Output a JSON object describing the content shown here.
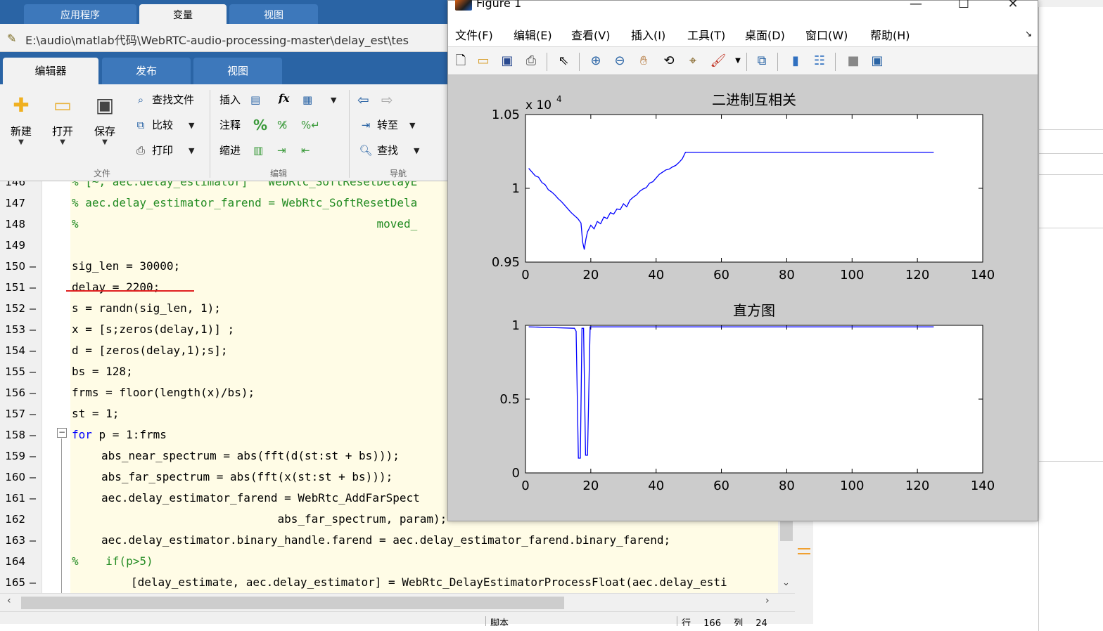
{
  "main": {
    "top_tabs": [
      "应用程序",
      "变量",
      "视图"
    ],
    "file_path": "E:\\audio\\matlab代码\\WebRTC-audio-processing-master\\delay_est\\tes",
    "ribbon_tabs": [
      "编辑器",
      "发布",
      "视图"
    ],
    "ribbon": {
      "new": "新建",
      "open": "打开",
      "save": "保存",
      "find_files": "查找文件",
      "compare": "比较",
      "print": "打印",
      "insert": "插入",
      "comment": "注释",
      "indent": "缩进",
      "goto": "转至",
      "find": "查找",
      "group_file": "文件",
      "group_edit": "编辑",
      "group_nav": "导航",
      "fx": "fx",
      "percent": "%"
    }
  },
  "editor": {
    "lines": [
      {
        "n": "146",
        "dash": "",
        "text": "% [~, aec.delay_estimator]   WebRtc_SoftResetDelayE",
        "cls": "cmt",
        "indent": 0
      },
      {
        "n": "147",
        "dash": "",
        "text": "% aec.delay_estimator_farend = WebRtc_SoftResetDela",
        "cls": "cmt",
        "indent": 0
      },
      {
        "n": "148",
        "dash": "",
        "text": "%                                            moved_",
        "cls": "cmt",
        "indent": 0
      },
      {
        "n": "149",
        "dash": "",
        "text": "",
        "cls": "",
        "indent": 0
      },
      {
        "n": "150",
        "dash": "—",
        "text": "sig_len = 30000;",
        "cls": "",
        "indent": 0
      },
      {
        "n": "151",
        "dash": "—",
        "text": "delay = 2200;",
        "cls": "",
        "indent": 0
      },
      {
        "n": "152",
        "dash": "—",
        "text": "s = randn(sig_len, 1);",
        "cls": "",
        "indent": 0
      },
      {
        "n": "153",
        "dash": "—",
        "text": "x = [s;zeros(delay,1)] ;",
        "cls": "",
        "indent": 0
      },
      {
        "n": "154",
        "dash": "—",
        "text": "d = [zeros(delay,1);s];",
        "cls": "",
        "indent": 0
      },
      {
        "n": "155",
        "dash": "—",
        "text": "bs = 128;",
        "cls": "",
        "indent": 0
      },
      {
        "n": "156",
        "dash": "—",
        "text": "frms = floor(length(x)/bs);",
        "cls": "",
        "indent": 0
      },
      {
        "n": "157",
        "dash": "—",
        "text": "st = 1;",
        "cls": "",
        "indent": 0
      },
      {
        "n": "158",
        "dash": "—",
        "text": "for p = 1:frms",
        "cls": "for",
        "indent": 0
      },
      {
        "n": "159",
        "dash": "—",
        "text": "abs_near_spectrum = abs(fft(d(st:st + bs)));",
        "cls": "",
        "indent": 1
      },
      {
        "n": "160",
        "dash": "—",
        "text": "abs_far_spectrum = abs(fft(x(st:st + bs)));",
        "cls": "",
        "indent": 1
      },
      {
        "n": "161",
        "dash": "—",
        "text": "aec.delay_estimator_farend = WebRtc_AddFarSpect",
        "cls": "",
        "indent": 1
      },
      {
        "n": "162",
        "dash": "",
        "text": "                          abs_far_spectrum, param);",
        "cls": "",
        "indent": 1
      },
      {
        "n": "163",
        "dash": "—",
        "text": "aec.delay_estimator.binary_handle.farend = aec.delay_estimator_farend.binary_farend;",
        "cls": "",
        "indent": 1
      },
      {
        "n": "164",
        "dash": "",
        "text": "%    if(p>5)",
        "cls": "cmt",
        "indent": 0
      },
      {
        "n": "165",
        "dash": "—",
        "text": "[delay_estimate, aec.delay_estimator] = WebRtc_DelayEstimatorProcessFloat(aec.delay_esti",
        "cls": "",
        "indent": 2
      }
    ]
  },
  "status": {
    "mode": "脚本",
    "row_label": "行",
    "row": "166",
    "col_label": "列",
    "col": "24"
  },
  "figure": {
    "title": "Figure 1",
    "menu": [
      "文件(F)",
      "编辑(E)",
      "查看(V)",
      "插入(I)",
      "工具(T)",
      "桌面(D)",
      "窗口(W)",
      "帮助(H)"
    ],
    "window_controls": {
      "min": "—",
      "max": "☐",
      "close": "✕"
    },
    "menu_arrow": "↘"
  },
  "chart_data": [
    {
      "type": "line",
      "title": "二进制互相关",
      "xlabel": "",
      "ylabel": "",
      "exponent_label": "x 10",
      "exponent_power": "4",
      "xlim": [
        0,
        140
      ],
      "ylim": [
        0.95,
        1.05
      ],
      "xticks": [
        0,
        20,
        40,
        60,
        80,
        100,
        120,
        140
      ],
      "yticks": [
        0.95,
        1,
        1.05
      ],
      "ytick_labels": [
        "0.95",
        "1",
        "1.05"
      ],
      "grid": false,
      "series": [
        {
          "color": "#0000ff",
          "x": [
            1,
            2,
            3,
            4,
            5,
            6,
            7,
            8,
            9,
            10,
            11,
            12,
            13,
            14,
            15,
            16,
            17,
            17.5,
            18,
            18.5,
            19,
            20,
            21,
            22,
            23,
            24,
            25,
            26,
            27,
            28,
            29,
            30,
            31,
            32,
            33,
            34,
            35,
            36,
            37,
            38,
            39,
            40,
            41,
            42,
            43,
            44,
            45,
            46,
            47,
            48,
            49,
            50,
            60,
            80,
            100,
            125
          ],
          "y": [
            1.0135,
            1.011,
            1.0085,
            1.0075,
            1.004,
            1.0025,
            0.999,
            0.9975,
            0.9955,
            0.993,
            0.991,
            0.9885,
            0.986,
            0.9835,
            0.9815,
            0.9795,
            0.9765,
            0.9635,
            0.9585,
            0.9655,
            0.9705,
            0.975,
            0.9725,
            0.9775,
            0.976,
            0.9805,
            0.9795,
            0.9835,
            0.9825,
            0.986,
            0.9855,
            0.9895,
            0.9875,
            0.992,
            0.994,
            0.9955,
            0.998,
            0.9995,
            1.0005,
            1.0035,
            1.0045,
            1.007,
            1.0095,
            1.011,
            1.0125,
            1.013,
            1.0145,
            1.0155,
            1.0175,
            1.02,
            1.0245,
            1.0245,
            1.0245,
            1.0245,
            1.0245,
            1.0245
          ]
        }
      ]
    },
    {
      "type": "line",
      "title": "直方图",
      "xlabel": "",
      "ylabel": "",
      "xlim": [
        0,
        140
      ],
      "ylim": [
        0,
        1
      ],
      "xticks": [
        0,
        20,
        40,
        60,
        80,
        100,
        120,
        140
      ],
      "yticks": [
        0,
        0.5,
        1
      ],
      "ytick_labels": [
        "0",
        "0.5",
        "1"
      ],
      "grid": false,
      "series": [
        {
          "color": "#0000ff",
          "x": [
            1,
            15,
            15.5,
            16.2,
            16.8,
            17.3,
            17.8,
            18.4,
            19,
            19.8,
            20.5,
            125
          ],
          "y": [
            0.99,
            0.98,
            0.96,
            0.1,
            0.1,
            0.98,
            0.98,
            0.12,
            0.12,
            0.99,
            0.99,
            0.99
          ]
        }
      ]
    }
  ]
}
